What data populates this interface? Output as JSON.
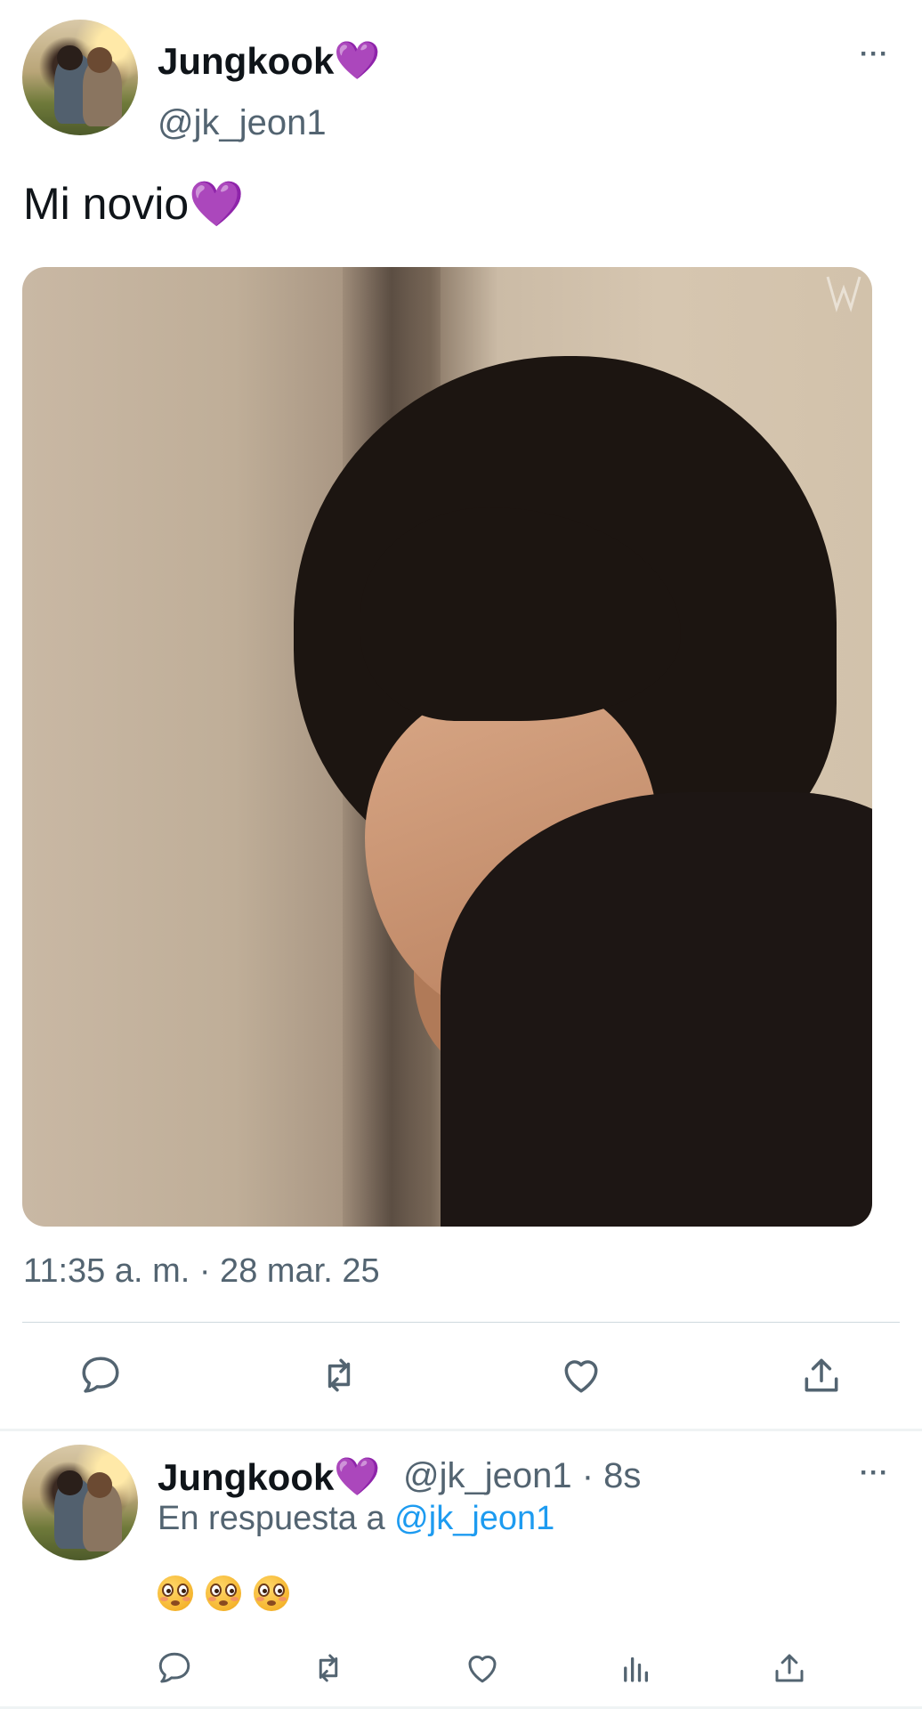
{
  "tweet": {
    "author_name": "Jungkook",
    "author_heart": "💜",
    "author_handle": "@jk_jeon1",
    "more_icon": "···",
    "text": "Mi novio💜",
    "timestamp": "11:35 a. m. · 28 mar. 25",
    "actions": [
      "reply-icon",
      "retweet-icon",
      "like-icon",
      "share-icon"
    ]
  },
  "reply": {
    "author_name": "Jungkook",
    "author_heart": "💜",
    "author_handle_time": "@jk_jeon1 · 8s",
    "more_icon": "···",
    "reply_prefix": "En respuesta a ",
    "reply_mention": "@jk_jeon1",
    "emojis": [
      "flushed-face",
      "flushed-face",
      "flushed-face"
    ],
    "actions": [
      "reply-icon",
      "retweet-icon",
      "like-icon",
      "analytics-icon",
      "share-icon"
    ]
  },
  "colors": {
    "accent": "#1d9bf0",
    "secondary_text": "#536471",
    "heart": "#a855f7"
  }
}
